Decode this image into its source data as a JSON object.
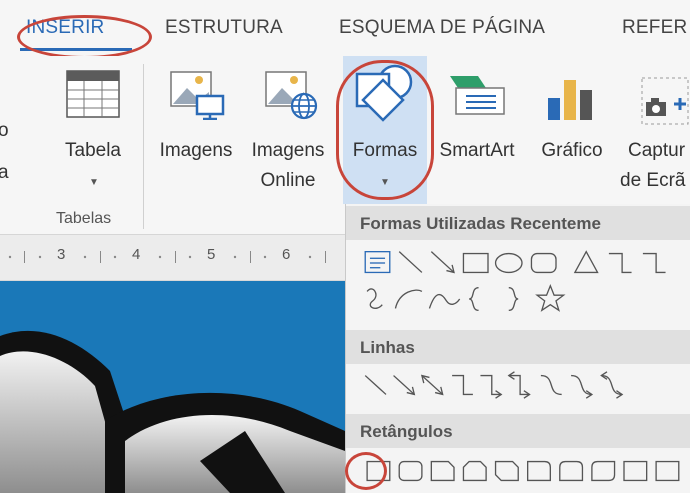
{
  "tabs": [
    {
      "label": "INSERIR",
      "active": true
    },
    {
      "label": "ESTRUTURA",
      "active": false
    },
    {
      "label": "ESQUEMA DE PÁGINA",
      "active": false
    },
    {
      "label": "REFER",
      "active": false
    }
  ],
  "left_edge": {
    "line1": "o",
    "line2": "a"
  },
  "ribbon": {
    "tabela_label": "Tabela",
    "tabelas_group": "Tabelas",
    "imagens_label": "Imagens",
    "imagens_online_line1": "Imagens",
    "imagens_online_line2": "Online",
    "formas_label": "Formas",
    "smartart_label": "SmartArt",
    "grafico_label": "Gráfico",
    "captura_line1": "Captur",
    "captura_line2": "de Ecrã"
  },
  "ruler": {
    "ticks": [
      "3",
      "4",
      "5",
      "6"
    ]
  },
  "dropdown": {
    "recent_header": "Formas Utilizadas Recenteme",
    "lines_header": "Linhas",
    "rect_header": "Retângulos"
  },
  "colors": {
    "accent": "#2a6ab6",
    "highlight_circle": "#c8453a",
    "formas_selected_bg": "#cfe0f3",
    "canvas_bg": "#1a78b8"
  },
  "icons": {
    "tabela": "table-icon",
    "imagens": "picture-icon",
    "imagens_online": "online-picture-icon",
    "formas": "shapes-icon",
    "smartart": "smartart-icon",
    "grafico": "chart-icon",
    "captura": "camera-icon"
  }
}
